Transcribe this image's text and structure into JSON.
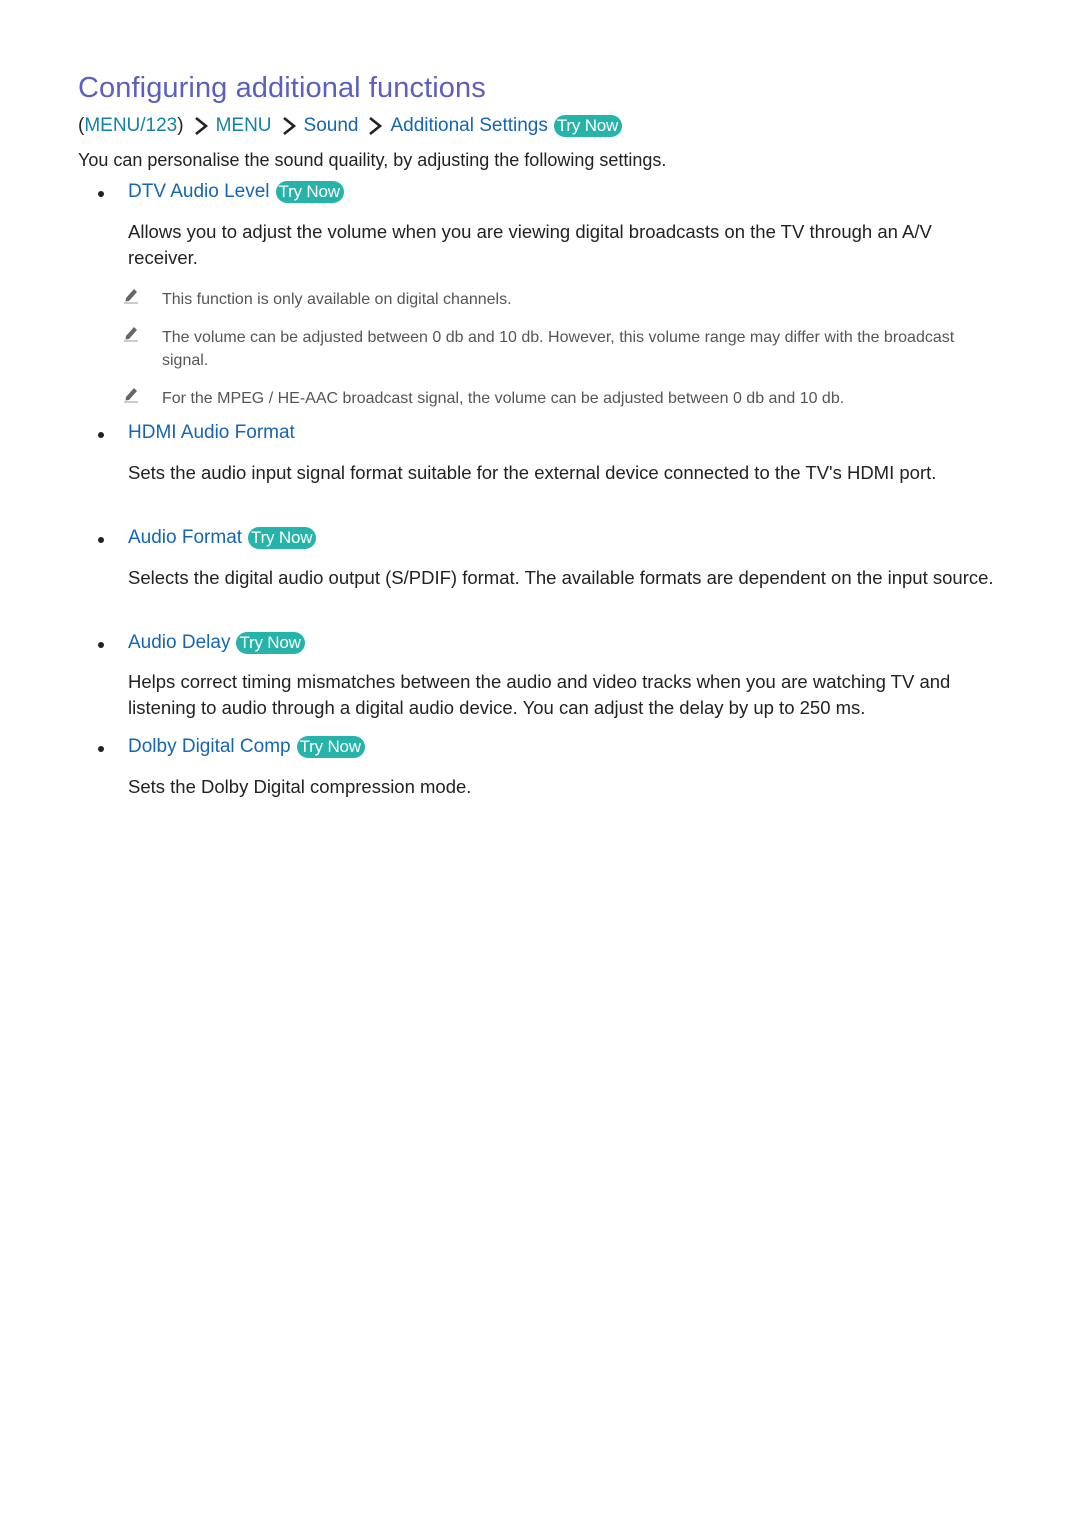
{
  "title": "Configuring additional functions",
  "breadcrumb": {
    "open_paren": "(",
    "menu_123": "MENU/123",
    "close_paren": ")",
    "menu": "MENU",
    "sound": "Sound",
    "additional_settings": "Additional Settings",
    "try_now": "Try Now"
  },
  "intro": "You can personalise the sound quaility, by adjusting the following settings.",
  "items": [
    {
      "label": "DTV Audio Level",
      "try_now": "Try Now",
      "description": "Allows you to adjust the volume when you are viewing digital broadcasts on the TV through an A/V receiver.",
      "notes": [
        "This function is only available on digital channels.",
        "The volume can be adjusted between 0 db and 10 db. However, this volume range may differ with the broadcast signal.",
        "For the MPEG / HE-AAC broadcast signal, the volume can be adjusted between 0 db and 10 db."
      ]
    },
    {
      "label": "HDMI Audio Format",
      "description": "Sets the audio input signal format suitable for the external device connected to the TV's HDMI port."
    },
    {
      "label": "Audio Format",
      "try_now": "Try Now",
      "description": "Selects the digital audio output (S/PDIF) format. The available formats are dependent on the input source."
    },
    {
      "label": "Audio Delay",
      "try_now": "Try Now",
      "description": "Helps correct timing mismatches between the audio and video tracks when you are watching TV and listening to audio through a digital audio device. You can adjust the delay by up to 250 ms."
    },
    {
      "label": "Dolby Digital Comp",
      "try_now": "Try Now",
      "description": "Sets the Dolby Digital compression mode."
    }
  ],
  "colors": {
    "title": "#5b5fbf",
    "link": "#1565b3",
    "menu_teal": "#1283a8",
    "badge": "#26b3a9",
    "note_text": "#555555"
  }
}
